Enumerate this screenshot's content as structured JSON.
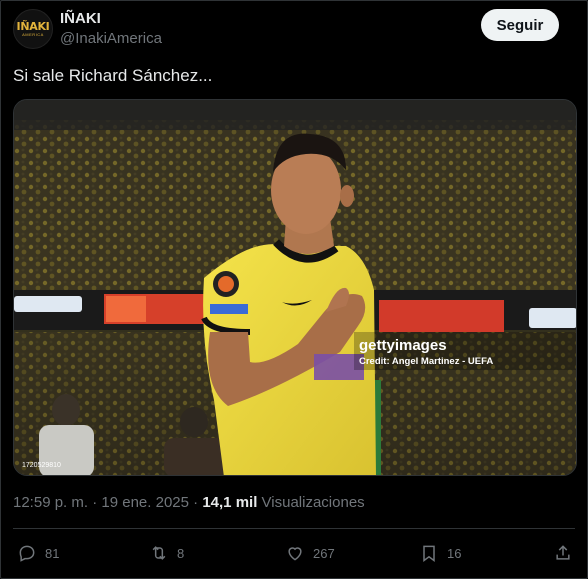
{
  "user": {
    "display_name": "IÑAKI",
    "handle": "@InakiAmerica",
    "avatar_text": "IÑAKI",
    "avatar_subtext": "AMERICA"
  },
  "follow_label": "Seguir",
  "tweet": {
    "text": "Si sale Richard Sánchez..."
  },
  "media": {
    "watermark_brand": "gettyimages",
    "credit": "Credit: Angel Martinez - UEFA",
    "image_id": "1720529810",
    "subject": "soccer player in yellow jersey, hand on chest"
  },
  "meta": {
    "time": "12:59 p. m.",
    "separator": " · ",
    "date": "19 ene. 2025",
    "views_count": "14,1 mil",
    "views_label": "Visualizaciones"
  },
  "actions": {
    "replies": "81",
    "reposts": "8",
    "likes": "267",
    "bookmarks": "16"
  },
  "icons": [
    "reply-icon",
    "repost-icon",
    "like-icon",
    "bookmark-icon",
    "share-icon"
  ],
  "colors": {
    "background": "#000000",
    "text": "#e7e9ea",
    "muted": "#71767b",
    "border": "#2f3336",
    "jersey": "#f0dc3c"
  }
}
